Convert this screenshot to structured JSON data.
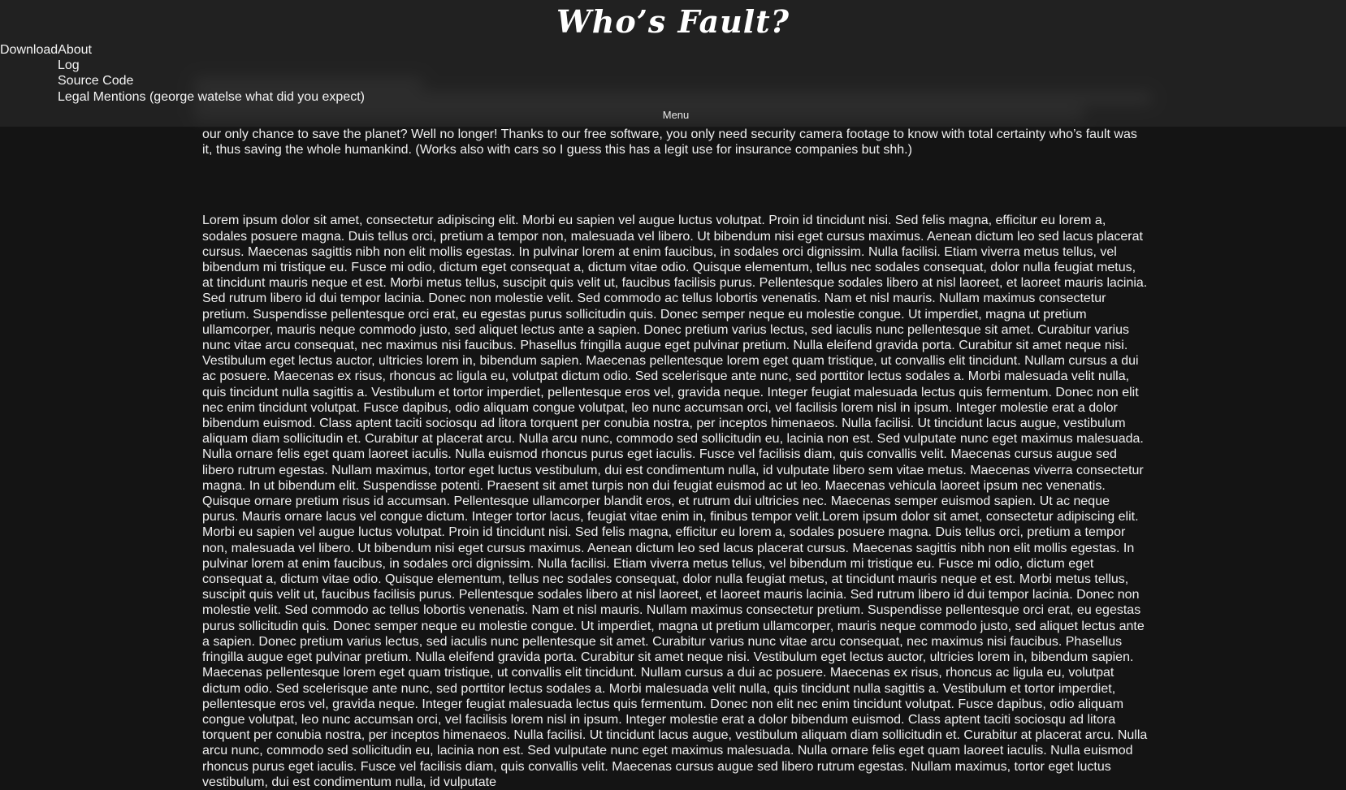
{
  "site": {
    "title": "Who’s Fault?"
  },
  "nav": {
    "download": "Download",
    "about": "About",
    "about_items": [
      "Log",
      "Source Code",
      "Legal Mentions (george watelse what did you expect)"
    ],
    "menu_label": "Menu"
  },
  "intro": {
    "text_visible": "our only chance to save the planet? Well no longer! Thanks to our free software, you only need security camera footage to know with total certainty who’s fault was it, thus saving the whole humankind. (Works also with cars so I guess this has a legit use for insurance companies but shh.)"
  },
  "body": {
    "lorem": "Lorem ipsum dolor sit amet, consectetur adipiscing elit. Morbi eu sapien vel augue luctus volutpat. Proin id tincidunt nisi. Sed felis magna, efficitur eu lorem a, sodales posuere magna. Duis tellus orci, pretium a tempor non, malesuada vel libero. Ut bibendum nisi eget cursus maximus. Aenean dictum leo sed lacus placerat cursus. Maecenas sagittis nibh non elit mollis egestas. In pulvinar lorem at enim faucibus, in sodales orci dignissim. Nulla facilisi. Etiam viverra metus tellus, vel bibendum mi tristique eu. Fusce mi odio, dictum eget consequat a, dictum vitae odio. Quisque elementum, tellus nec sodales consequat, dolor nulla feugiat metus, at tincidunt mauris neque et est. Morbi metus tellus, suscipit quis velit ut, faucibus facilisis purus. Pellentesque sodales libero at nisl laoreet, et laoreet mauris lacinia. Sed rutrum libero id dui tempor lacinia. Donec non molestie velit. Sed commodo ac tellus lobortis venenatis. Nam et nisl mauris. Nullam maximus consectetur pretium. Suspendisse pellentesque orci erat, eu egestas purus sollicitudin quis. Donec semper neque eu molestie congue. Ut imperdiet, magna ut pretium ullamcorper, mauris neque commodo justo, sed aliquet lectus ante a sapien. Donec pretium varius lectus, sed iaculis nunc pellentesque sit amet. Curabitur varius nunc vitae arcu consequat, nec maximus nisi faucibus. Phasellus fringilla augue eget pulvinar pretium. Nulla eleifend gravida porta. Curabitur sit amet neque nisi. Vestibulum eget lectus auctor, ultricies lorem in, bibendum sapien. Maecenas pellentesque lorem eget quam tristique, ut convallis elit tincidunt. Nullam cursus a dui ac posuere. Maecenas ex risus, rhoncus ac ligula eu, volutpat dictum odio. Sed scelerisque ante nunc, sed porttitor lectus sodales a. Morbi malesuada velit nulla, quis tincidunt nulla sagittis a. Vestibulum et tortor imperdiet, pellentesque eros vel, gravida neque. Integer feugiat malesuada lectus quis fermentum. Donec non elit nec enim tincidunt volutpat. Fusce dapibus, odio aliquam congue volutpat, leo nunc accumsan orci, vel facilisis lorem nisl in ipsum. Integer molestie erat a dolor bibendum euismod. Class aptent taciti sociosqu ad litora torquent per conubia nostra, per inceptos himenaeos. Nulla facilisi. Ut tincidunt lacus augue, vestibulum aliquam diam sollicitudin et. Curabitur at placerat arcu. Nulla arcu nunc, commodo sed sollicitudin eu, lacinia non est. Sed vulputate nunc eget maximus malesuada. Nulla ornare felis eget quam laoreet iaculis. Nulla euismod rhoncus purus eget iaculis. Fusce vel facilisis diam, quis convallis velit. Maecenas cursus augue sed libero rutrum egestas. Nullam maximus, tortor eget luctus vestibulum, dui est condimentum nulla, id vulputate libero sem vitae metus. Maecenas viverra consectetur magna. In ut bibendum elit. Suspendisse potenti. Praesent sit amet turpis non dui feugiat euismod ac ut leo. Maecenas vehicula laoreet ipsum nec venenatis. Quisque ornare pretium risus id accumsan. Pellentesque ullamcorper blandit eros, et rutrum dui ultricies nec. Maecenas semper euismod sapien. Ut ac neque purus. Mauris ornare lacus vel congue dictum. Integer tortor lacus, feugiat vitae enim in, finibus tempor velit.Lorem ipsum dolor sit amet, consectetur adipiscing elit. Morbi eu sapien vel augue luctus volutpat. Proin id tincidunt nisi. Sed felis magna, efficitur eu lorem a, sodales posuere magna. Duis tellus orci, pretium a tempor non, malesuada vel libero. Ut bibendum nisi eget cursus maximus. Aenean dictum leo sed lacus placerat cursus. Maecenas sagittis nibh non elit mollis egestas. In pulvinar lorem at enim faucibus, in sodales orci dignissim. Nulla facilisi. Etiam viverra metus tellus, vel bibendum mi tristique eu. Fusce mi odio, dictum eget consequat a, dictum vitae odio. Quisque elementum, tellus nec sodales consequat, dolor nulla feugiat metus, at tincidunt mauris neque et est. Morbi metus tellus, suscipit quis velit ut, faucibus facilisis purus. Pellentesque sodales libero at nisl laoreet, et laoreet mauris lacinia. Sed rutrum libero id dui tempor lacinia. Donec non molestie velit. Sed commodo ac tellus lobortis venenatis. Nam et nisl mauris. Nullam maximus consectetur pretium. Suspendisse pellentesque orci erat, eu egestas purus sollicitudin quis. Donec semper neque eu molestie congue. Ut imperdiet, magna ut pretium ullamcorper, mauris neque commodo justo, sed aliquet lectus ante a sapien. Donec pretium varius lectus, sed iaculis nunc pellentesque sit amet. Curabitur varius nunc vitae arcu consequat, nec maximus nisi faucibus. Phasellus fringilla augue eget pulvinar pretium. Nulla eleifend gravida porta. Curabitur sit amet neque nisi. Vestibulum eget lectus auctor, ultricies lorem in, bibendum sapien. Maecenas pellentesque lorem eget quam tristique, ut convallis elit tincidunt. Nullam cursus a dui ac posuere. Maecenas ex risus, rhoncus ac ligula eu, volutpat dictum odio. Sed scelerisque ante nunc, sed porttitor lectus sodales a. Morbi malesuada velit nulla, quis tincidunt nulla sagittis a. Vestibulum et tortor imperdiet, pellentesque eros vel, gravida neque. Integer feugiat malesuada lectus quis fermentum. Donec non elit nec enim tincidunt volutpat. Fusce dapibus, odio aliquam congue volutpat, leo nunc accumsan orci, vel facilisis lorem nisl in ipsum. Integer molestie erat a dolor bibendum euismod. Class aptent taciti sociosqu ad litora torquent per conubia nostra, per inceptos himenaeos. Nulla facilisi. Ut tincidunt lacus augue, vestibulum aliquam diam sollicitudin et. Curabitur at placerat arcu. Nulla arcu nunc, commodo sed sollicitudin eu, lacinia non est. Sed vulputate nunc eget maximus malesuada. Nulla ornare felis eget quam laoreet iaculis. Nulla euismod rhoncus purus eget iaculis. Fusce vel facilisis diam, quis convallis velit. Maecenas cursus augue sed libero rutrum egestas. Nullam maximus, tortor eget luctus vestibulum, dui est condimentum nulla, id vulputate"
  },
  "colors": {
    "background": "#141414",
    "header": "#242424",
    "text": "#efefef"
  }
}
